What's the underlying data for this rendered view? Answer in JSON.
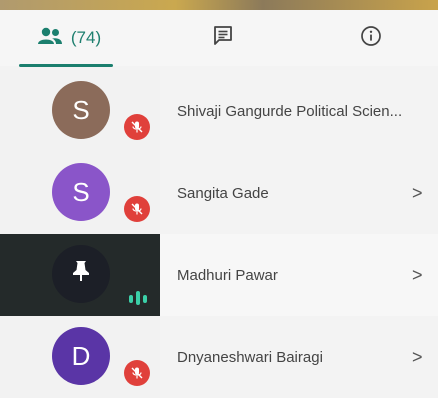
{
  "tabs": {
    "people_count": "(74)"
  },
  "participants": [
    {
      "initial": "S",
      "name": "Shivaji Gangurde Political Scien...",
      "avatar_color": "#8b6b5a",
      "muted": true,
      "has_chevron": false,
      "speaking": false
    },
    {
      "initial": "S",
      "name": "Sangita Gade",
      "avatar_color": "#8a55c9",
      "muted": true,
      "has_chevron": true,
      "speaking": false
    },
    {
      "initial": "",
      "name": "Madhuri Pawar",
      "avatar_color": "#1c1f27",
      "muted": false,
      "has_chevron": true,
      "speaking": true,
      "avatar_icon": "pin-icon"
    },
    {
      "initial": "D",
      "name": "Dnyaneshwari Bairagi",
      "avatar_color": "#5a35a6",
      "muted": true,
      "has_chevron": true,
      "speaking": false
    }
  ],
  "chevron": ">",
  "colors": {
    "accent": "#1b7f6e",
    "mute_badge": "#e0403b",
    "speaking_indicator": "#3bd0a8",
    "speaking_tile": "#242a2a"
  }
}
